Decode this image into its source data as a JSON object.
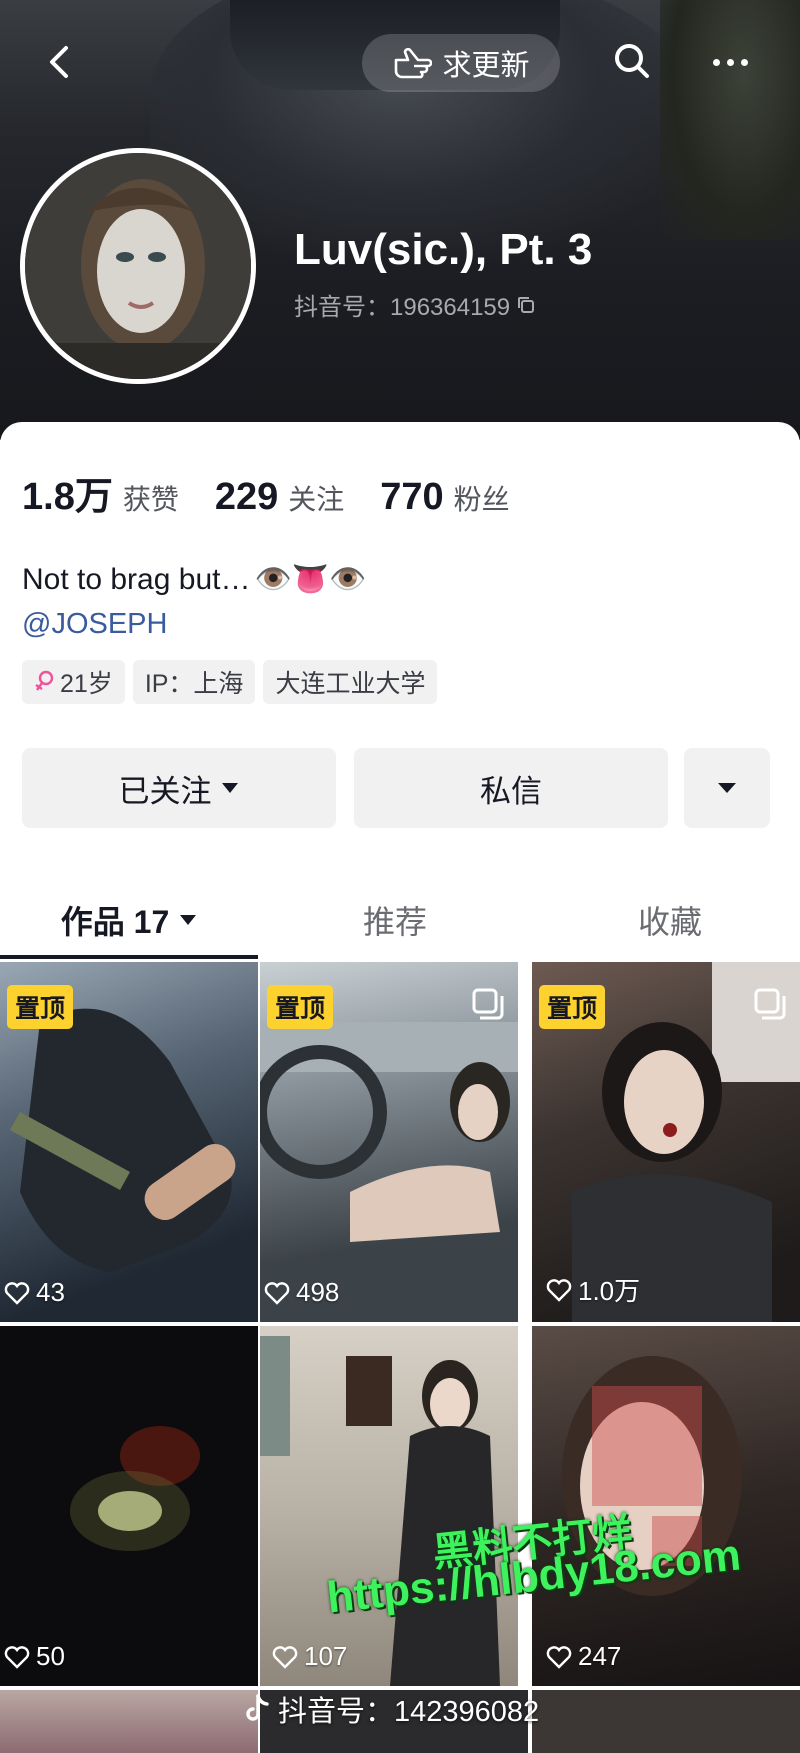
{
  "header": {
    "update_label": "求更新",
    "icons": [
      "back-arrow-icon",
      "hand-point-icon",
      "search-icon",
      "more-icon"
    ]
  },
  "profile": {
    "nickname": "Luv(sic.), Pt. 3",
    "douyin_id": "抖音号：196364159"
  },
  "stats": [
    {
      "value": "1.8万",
      "label": "获赞"
    },
    {
      "value": "229",
      "label": "关注"
    },
    {
      "value": "770",
      "label": "粉丝"
    }
  ],
  "bio": {
    "text": "Not to brag but…",
    "emoji": "👁️👅👁️",
    "mention": "@JOSEPH"
  },
  "tags": {
    "age": "21岁",
    "ip": "IP：上海",
    "school": "大连工业大学"
  },
  "actions": {
    "following": "已关注",
    "message": "私信"
  },
  "tabs": {
    "works": "作品 17",
    "recommend": "推荐",
    "favorites": "收藏"
  },
  "videos": [
    {
      "pinned": "置顶",
      "likes": "43"
    },
    {
      "pinned": "置顶",
      "likes": "498"
    },
    {
      "pinned": "置顶",
      "likes": "1.0万"
    },
    {
      "likes": "50"
    },
    {
      "likes": "107"
    },
    {
      "likes": "247"
    }
  ],
  "watermark": {
    "line1": "黑料不打烊",
    "line2": "https://hlbdy18.com",
    "footer_id": "抖音号：142396082"
  },
  "colors": {
    "pin_badge": "#fdd22f",
    "mention": "#3a5b9e",
    "watermark": "#3df25c",
    "header_bg": "#1c1d22"
  }
}
